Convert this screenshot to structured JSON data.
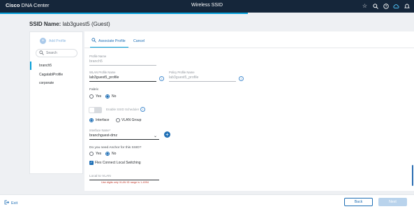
{
  "header": {
    "brand_bold": "Cisco",
    "brand_rest": "DNA Center",
    "title": "Wireless SSID",
    "icons": [
      "star-icon",
      "search-icon",
      "help-icon",
      "cloud-icon",
      "bell-icon"
    ]
  },
  "page": {
    "ssid_label": "SSID Name:",
    "ssid_value": "lab3guest5 (Guest)"
  },
  "left_panel": {
    "add_profile_label": "Add Profile",
    "search_placeholder": "Search",
    "profiles": [
      {
        "label": "branch5",
        "active": true
      },
      {
        "label": "CagatablProfile",
        "active": false
      },
      {
        "label": "corporate",
        "active": false
      }
    ]
  },
  "main": {
    "associate_label": "Associate Profile",
    "cancel_label": "Cancel",
    "profile_name_label": "Profile Name",
    "profile_name_value": "branch5",
    "wlan_profile_label": "WLAN Profile Name",
    "wlan_profile_value": "lab3guest5_profile",
    "policy_profile_label": "Policy Profile Name",
    "policy_profile_value": "lab3guest5_profile",
    "fabric_label": "Fabric",
    "fabric_options": [
      "Yes",
      "No"
    ],
    "fabric_selected": "No",
    "ssid_scheduler_label": "Enable SSID Scheduler",
    "assign_options": [
      "Interface",
      "VLAN Group"
    ],
    "assign_selected": "Interface",
    "interface_label": "Interface Name*",
    "interface_value": "branchguest-dmz",
    "anchor_label": "Do you need Anchor for this SSID?",
    "anchor_options": [
      "Yes",
      "No"
    ],
    "anchor_selected": "No",
    "flex_label": "Flex Connect Local Switching",
    "flex_checked": true,
    "local_vlan_label": "Local to VLAN",
    "local_vlan_error": "Use digits only VLAN ID range is 1-4094"
  },
  "footer": {
    "exit_label": "Exit",
    "back_label": "Back",
    "next_label": "Next"
  },
  "colors": {
    "topbar": "#15263a",
    "accent": "#049fd9",
    "link": "#1f6fb5",
    "error": "#c0392b"
  }
}
